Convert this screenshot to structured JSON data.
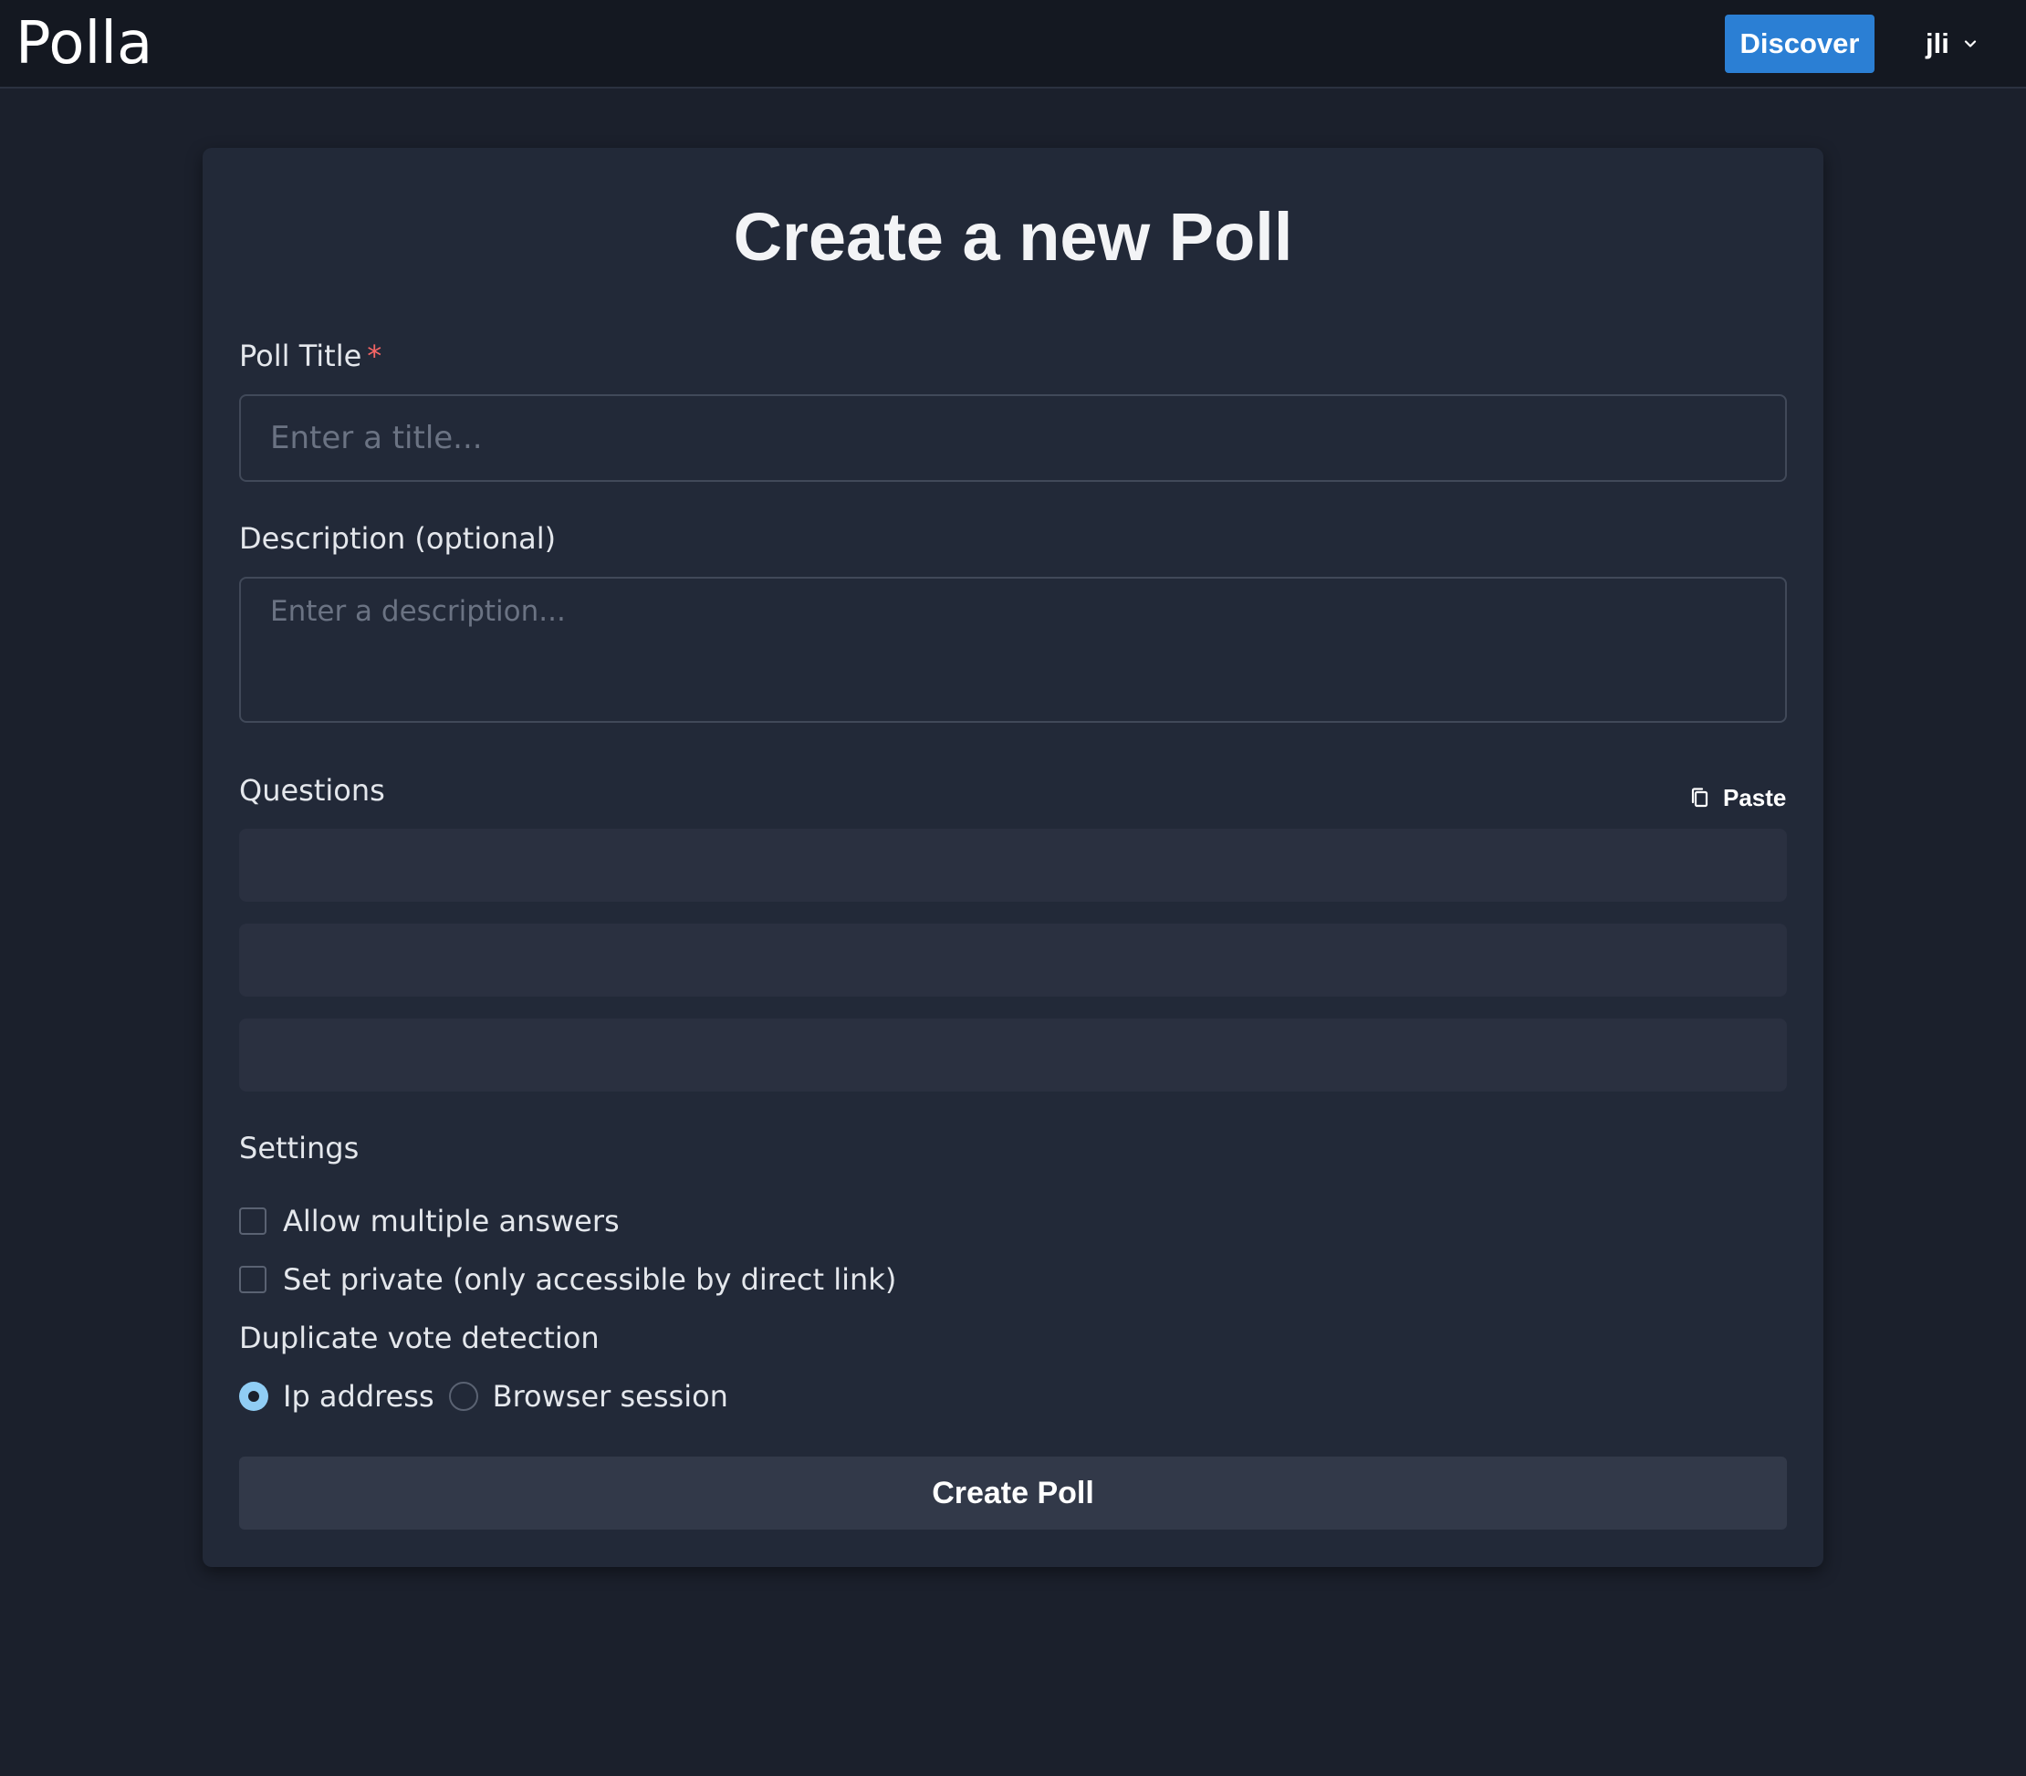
{
  "app": {
    "name": "Polla"
  },
  "navbar": {
    "discover_label": "Discover",
    "username": "jli",
    "user_menu_icon": "chevron-down-icon"
  },
  "form": {
    "heading": "Create a new Poll",
    "title_label": "Poll Title",
    "required_marker": "*",
    "title_placeholder": "Enter a title...",
    "title_value": "",
    "description_label": "Description (optional)",
    "description_placeholder": "Enter a description...",
    "description_value": "",
    "questions_label": "Questions",
    "paste_label": "Paste",
    "paste_icon": "copy-icon",
    "question_slots": 3,
    "settings_label": "Settings",
    "settings": {
      "allow_multiple_label": "Allow multiple answers",
      "allow_multiple_checked": false,
      "private_label": "Set private (only accessible by direct link)",
      "private_checked": false
    },
    "duplicate_detection": {
      "label": "Duplicate vote detection",
      "options": [
        "Ip address",
        "Browser session"
      ],
      "selected": "Ip address"
    },
    "submit_label": "Create Poll"
  },
  "colors": {
    "background": "#1b202c",
    "navbar": "#141821",
    "card": "#222938",
    "accent": "#2b7fd4",
    "radio_selected": "#90cdf4",
    "required": "#f56565"
  }
}
